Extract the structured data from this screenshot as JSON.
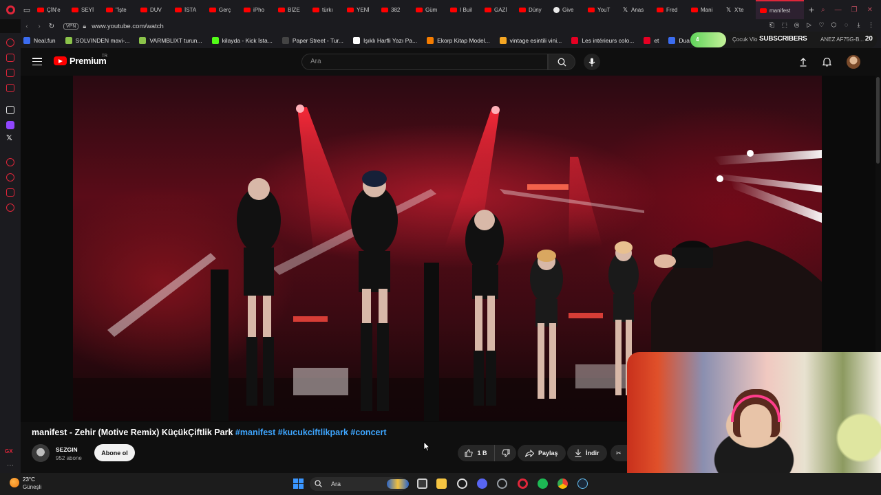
{
  "browser": {
    "tabs": [
      {
        "label": "ÇİN'e",
        "icon": "youtube-icon"
      },
      {
        "label": "SEYİ",
        "icon": "youtube-icon"
      },
      {
        "label": "\"İşte",
        "icon": "youtube-icon"
      },
      {
        "label": "DUV",
        "icon": "youtube-icon"
      },
      {
        "label": "İSTA",
        "icon": "youtube-icon"
      },
      {
        "label": "Gerç",
        "icon": "youtube-icon"
      },
      {
        "label": "iPho",
        "icon": "youtube-icon"
      },
      {
        "label": "BİZE",
        "icon": "youtube-icon"
      },
      {
        "label": "türkı",
        "icon": "youtube-icon"
      },
      {
        "label": "YENİ",
        "icon": "youtube-icon"
      },
      {
        "label": "382",
        "icon": "youtube-icon"
      },
      {
        "label": "Güm",
        "icon": "youtube-icon"
      },
      {
        "label": "I Buil",
        "icon": "youtube-icon"
      },
      {
        "label": "GAZİ",
        "icon": "youtube-icon"
      },
      {
        "label": "Düny",
        "icon": "youtube-icon"
      },
      {
        "label": "Give",
        "icon": "github-icon"
      },
      {
        "label": "YouT",
        "icon": "youtube-icon"
      },
      {
        "label": "Anas",
        "icon": "x-icon"
      },
      {
        "label": "Fred",
        "icon": "youtube-icon"
      },
      {
        "label": "Mani",
        "icon": "youtube-icon"
      },
      {
        "label": "X'te",
        "icon": "x-icon"
      }
    ],
    "active_tab": {
      "label": "manifest",
      "icon": "youtube-icon"
    },
    "new_tab": "+",
    "address": {
      "vpn": "VPN",
      "url": "www.youtube.com/watch"
    },
    "bookmarks": [
      {
        "label": "Neal.fun",
        "color": "#3b6cf0"
      },
      {
        "label": "SOLVINDEN mavi-...",
        "color": "#8bc34a"
      },
      {
        "label": "VARMBLIXT turun...",
        "color": "#8bc34a"
      },
      {
        "label": "kilayda - Kick İsta...",
        "color": "#53fc18"
      },
      {
        "label": "Paper Street - Tur...",
        "color": "#444444"
      },
      {
        "label": "Işıklı Harfli Yazı Pa...",
        "color": "#ffffff"
      },
      {
        "label": "Ekorp Kitap Model...",
        "color": "#f57c00"
      },
      {
        "label": "vintage esintili vini...",
        "color": "#f5a623"
      },
      {
        "label": "Les intérieurs colo...",
        "color": "#e60023"
      },
      {
        "label": "et",
        "color": "#e60023"
      },
      {
        "label": "Dual Cam",
        "color": "#3b6cf0"
      }
    ]
  },
  "subscribers_widget": {
    "pill_value": "4",
    "ticker": "Çocuk Vlo",
    "label": "SUBSCRIBERS",
    "ticker_right": "ANEZ AF75G-B...",
    "count": "20"
  },
  "youtube": {
    "logo_text": "Premium",
    "region": "TR",
    "search_placeholder": "Ara",
    "video": {
      "title_main": "manifest - Zehir (Motive Remix) KüçükÇiftlik Park",
      "hashtags": [
        "#manifest",
        "#kucukciftlikpark",
        "#concert"
      ]
    },
    "channel": {
      "name": "SEZGIN",
      "subscribers": "952 abone"
    },
    "subscribe_label": "Abone ol",
    "likes": "1 B",
    "share_label": "Paylaş",
    "download_label": "İndir"
  },
  "taskbar": {
    "temperature": "23°C",
    "condition": "Güneşli",
    "search_placeholder": "Ara"
  }
}
